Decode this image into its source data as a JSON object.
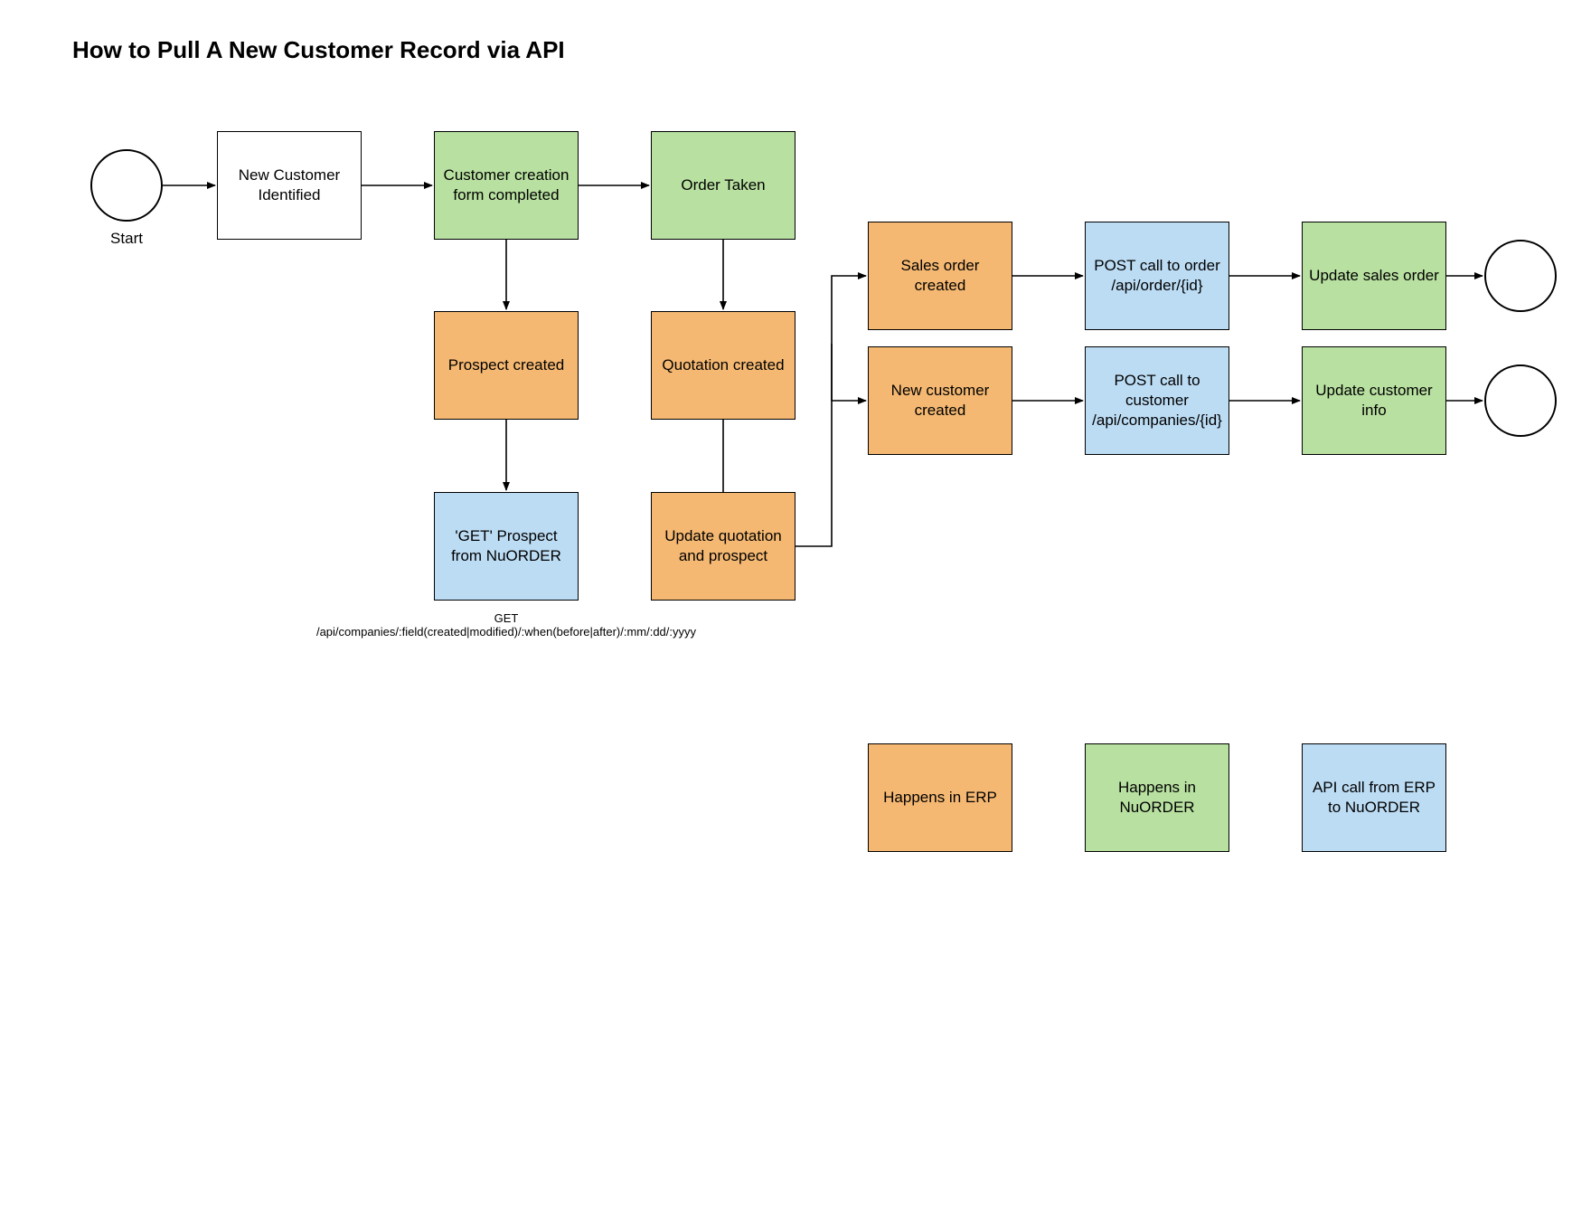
{
  "title": "How to Pull A New Customer Record via API",
  "start_label": "Start",
  "nodes": {
    "new_customer_identified": "New Customer Identified",
    "customer_creation_form": "Customer creation form completed",
    "order_taken": "Order Taken",
    "prospect_created": "Prospect created",
    "quotation_created": "Quotation created",
    "get_prospect": "'GET' Prospect from NuORDER",
    "update_quotation": "Update quotation and prospect",
    "sales_order_created": "Sales order created",
    "new_customer_created": "New customer created",
    "post_order": "POST call to order /api/order/{id}",
    "post_customer": "POST call to customer /api/companies/{id}",
    "update_sales_order": "Update sales order",
    "update_customer_info": "Update customer info"
  },
  "get_caption": "GET\n/api/companies/:field(created|modified)/:when(before|after)/:mm/:dd/:yyyy",
  "legend": {
    "erp": "Happens in ERP",
    "nuorder": "Happens in NuORDER",
    "api": "API call from ERP to NuORDER"
  },
  "colors": {
    "orange": "#f4b872",
    "green": "#b8e0a0",
    "blue": "#bcdcf4",
    "white": "#ffffff",
    "stroke": "#000000"
  }
}
